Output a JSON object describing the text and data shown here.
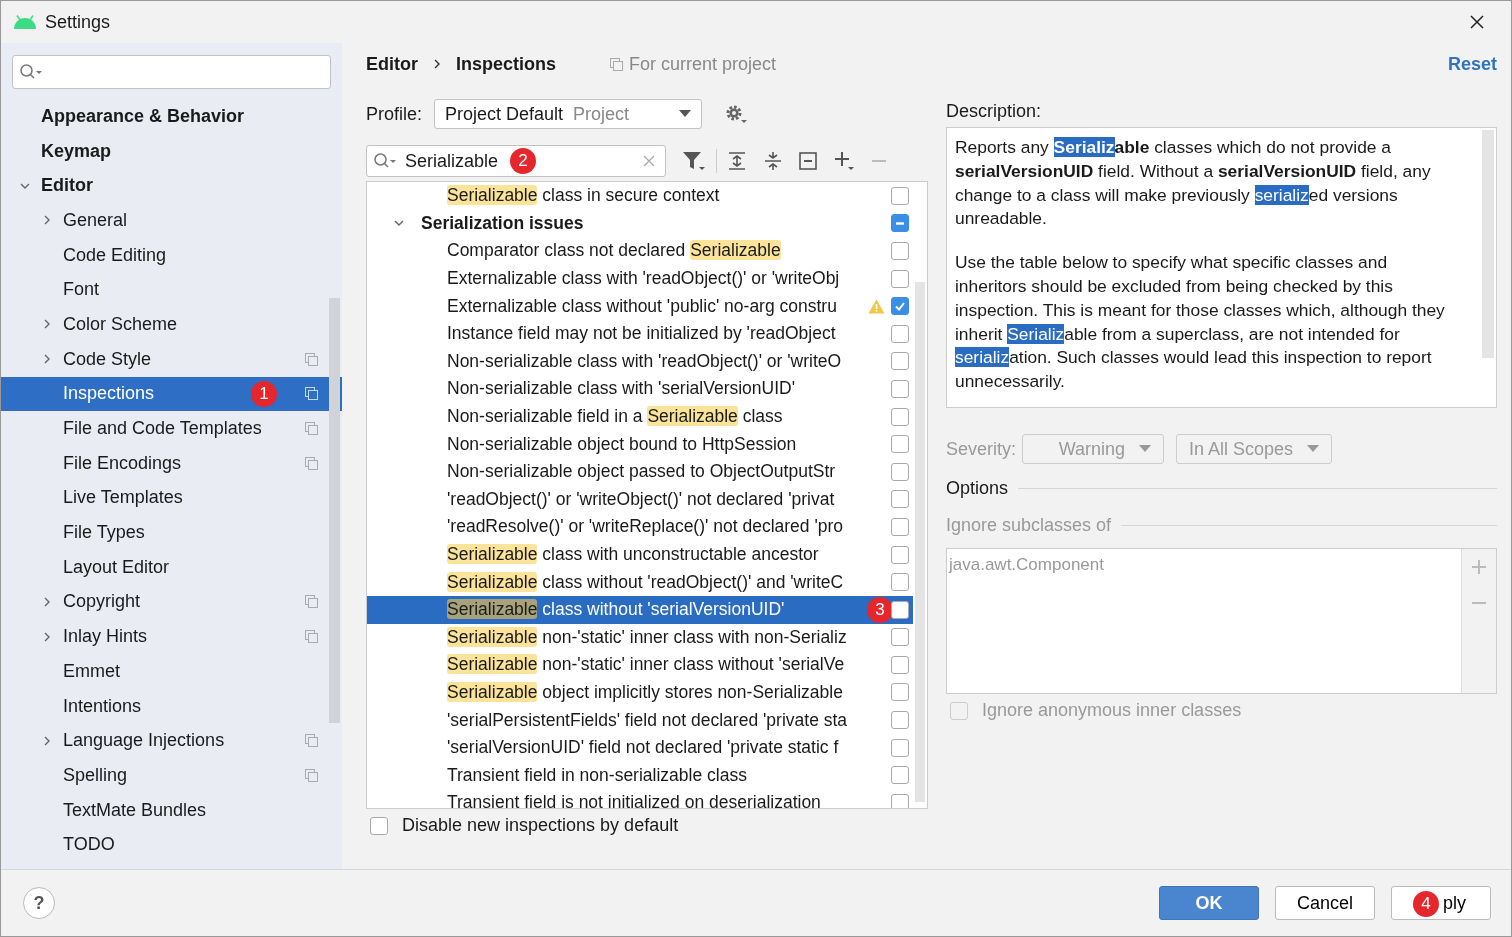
{
  "window": {
    "title": "Settings"
  },
  "sidebar": {
    "items": [
      {
        "label": "Appearance & Behavior",
        "expandable": false,
        "selected": false,
        "project_scope": false
      },
      {
        "label": "Keymap",
        "expandable": false,
        "selected": false,
        "project_scope": false
      },
      {
        "label": "Editor",
        "expandable": true,
        "expanded": true,
        "selected": false,
        "project_scope": false,
        "children": [
          {
            "label": "General",
            "expandable": true,
            "expanded": false,
            "selected": false,
            "project_scope": false
          },
          {
            "label": "Code Editing",
            "expandable": false,
            "selected": false,
            "project_scope": false
          },
          {
            "label": "Font",
            "expandable": false,
            "selected": false,
            "project_scope": false
          },
          {
            "label": "Color Scheme",
            "expandable": true,
            "expanded": false,
            "selected": false,
            "project_scope": false
          },
          {
            "label": "Code Style",
            "expandable": true,
            "expanded": false,
            "selected": false,
            "project_scope": true
          },
          {
            "label": "Inspections",
            "expandable": false,
            "selected": true,
            "project_scope": true,
            "badge": "1"
          },
          {
            "label": "File and Code Templates",
            "expandable": false,
            "selected": false,
            "project_scope": true
          },
          {
            "label": "File Encodings",
            "expandable": false,
            "selected": false,
            "project_scope": true
          },
          {
            "label": "Live Templates",
            "expandable": false,
            "selected": false,
            "project_scope": false
          },
          {
            "label": "File Types",
            "expandable": false,
            "selected": false,
            "project_scope": false
          },
          {
            "label": "Layout Editor",
            "expandable": false,
            "selected": false,
            "project_scope": false
          },
          {
            "label": "Copyright",
            "expandable": true,
            "expanded": false,
            "selected": false,
            "project_scope": true
          },
          {
            "label": "Inlay Hints",
            "expandable": true,
            "expanded": false,
            "selected": false,
            "project_scope": true
          },
          {
            "label": "Emmet",
            "expandable": false,
            "selected": false,
            "project_scope": false
          },
          {
            "label": "Intentions",
            "expandable": false,
            "selected": false,
            "project_scope": false
          },
          {
            "label": "Language Injections",
            "expandable": true,
            "expanded": false,
            "selected": false,
            "project_scope": true
          },
          {
            "label": "Spelling",
            "expandable": false,
            "selected": false,
            "project_scope": true
          },
          {
            "label": "TextMate Bundles",
            "expandable": false,
            "selected": false,
            "project_scope": false
          },
          {
            "label": "TODO",
            "expandable": false,
            "selected": false,
            "project_scope": false
          }
        ]
      }
    ]
  },
  "breadcrumb": [
    "Editor",
    "Inspections"
  ],
  "scope_note": "For current project",
  "reset_link": "Reset",
  "profile": {
    "label": "Profile:",
    "value": "Project Default",
    "qualifier": "Project"
  },
  "filter_search": {
    "value": "Serializable",
    "badge": "2"
  },
  "inspections": [
    {
      "kind": "item",
      "parts": [
        {
          "kind": "match",
          "text": "Serializable"
        },
        {
          "kind": "plain",
          "text": " class in secure context"
        }
      ],
      "checked": false,
      "selected": false,
      "warning": false
    },
    {
      "kind": "group",
      "label": "Serialization issues",
      "expanded": true,
      "checked": false,
      "partial": true,
      "children": [
        {
          "kind": "item",
          "parts": [
            {
              "kind": "plain",
              "text": "Comparator class not declared "
            },
            {
              "kind": "match",
              "text": "Serializable"
            }
          ],
          "checked": false,
          "selected": false,
          "warning": false
        },
        {
          "kind": "item",
          "parts": [
            {
              "kind": "plain",
              "text": "Externalizable class with 'readObject()' or 'writeObj"
            }
          ],
          "checked": false,
          "selected": false,
          "warning": false
        },
        {
          "kind": "item",
          "parts": [
            {
              "kind": "plain",
              "text": "Externalizable class without 'public' no-arg constru"
            }
          ],
          "checked": true,
          "selected": false,
          "warning": true
        },
        {
          "kind": "item",
          "parts": [
            {
              "kind": "plain",
              "text": "Instance field may not be initialized by 'readObject"
            }
          ],
          "checked": false,
          "selected": false,
          "warning": false
        },
        {
          "kind": "item",
          "parts": [
            {
              "kind": "plain",
              "text": "Non-serializable class with 'readObject()' or 'writeO"
            }
          ],
          "checked": false,
          "selected": false,
          "warning": false
        },
        {
          "kind": "item",
          "parts": [
            {
              "kind": "plain",
              "text": "Non-serializable class with 'serialVersionUID'"
            }
          ],
          "checked": false,
          "selected": false,
          "warning": false
        },
        {
          "kind": "item",
          "parts": [
            {
              "kind": "plain",
              "text": "Non-serializable field in a "
            },
            {
              "kind": "match",
              "text": "Serializable"
            },
            {
              "kind": "plain",
              "text": " class"
            }
          ],
          "checked": false,
          "selected": false,
          "warning": false
        },
        {
          "kind": "item",
          "parts": [
            {
              "kind": "plain",
              "text": "Non-serializable object bound to HttpSession"
            }
          ],
          "checked": false,
          "selected": false,
          "warning": false
        },
        {
          "kind": "item",
          "parts": [
            {
              "kind": "plain",
              "text": "Non-serializable object passed to ObjectOutputStr"
            }
          ],
          "checked": false,
          "selected": false,
          "warning": false
        },
        {
          "kind": "item",
          "parts": [
            {
              "kind": "plain",
              "text": "'readObject()' or 'writeObject()' not declared 'privat"
            }
          ],
          "checked": false,
          "selected": false,
          "warning": false
        },
        {
          "kind": "item",
          "parts": [
            {
              "kind": "plain",
              "text": "'readResolve()' or 'writeReplace()' not declared 'pro"
            }
          ],
          "checked": false,
          "selected": false,
          "warning": false
        },
        {
          "kind": "item",
          "parts": [
            {
              "kind": "match",
              "text": "Serializable"
            },
            {
              "kind": "plain",
              "text": " class with unconstructable ancestor"
            }
          ],
          "checked": false,
          "selected": false,
          "warning": false
        },
        {
          "kind": "item",
          "parts": [
            {
              "kind": "match",
              "text": "Serializable"
            },
            {
              "kind": "plain",
              "text": " class without 'readObject()' and 'writeC"
            }
          ],
          "checked": false,
          "selected": false,
          "warning": false
        },
        {
          "kind": "item",
          "parts": [
            {
              "kind": "match",
              "text": "Serializable"
            },
            {
              "kind": "plain",
              "text": " class without 'serialVersionUID'"
            }
          ],
          "checked": false,
          "selected": true,
          "warning": false,
          "badge": "3"
        },
        {
          "kind": "item",
          "parts": [
            {
              "kind": "match",
              "text": "Serializable"
            },
            {
              "kind": "plain",
              "text": " non-'static' inner class with non-Serializ"
            }
          ],
          "checked": false,
          "selected": false,
          "warning": false
        },
        {
          "kind": "item",
          "parts": [
            {
              "kind": "match",
              "text": "Serializable"
            },
            {
              "kind": "plain",
              "text": " non-'static' inner class without 'serialVe"
            }
          ],
          "checked": false,
          "selected": false,
          "warning": false
        },
        {
          "kind": "item",
          "parts": [
            {
              "kind": "match",
              "text": "Serializable"
            },
            {
              "kind": "plain",
              "text": " object implicitly stores non-Serializable"
            }
          ],
          "checked": false,
          "selected": false,
          "warning": false
        },
        {
          "kind": "item",
          "parts": [
            {
              "kind": "plain",
              "text": "'serialPersistentFields' field not declared 'private sta"
            }
          ],
          "checked": false,
          "selected": false,
          "warning": false
        },
        {
          "kind": "item",
          "parts": [
            {
              "kind": "plain",
              "text": "'serialVersionUID' field not declared 'private static f"
            }
          ],
          "checked": false,
          "selected": false,
          "warning": false
        },
        {
          "kind": "item",
          "parts": [
            {
              "kind": "plain",
              "text": "Transient field in non-serializable class"
            }
          ],
          "checked": false,
          "selected": false,
          "warning": false
        },
        {
          "kind": "item",
          "parts": [
            {
              "kind": "plain",
              "text": "Transient field is not initialized on deserialization"
            }
          ],
          "checked": false,
          "selected": false,
          "warning": false
        }
      ]
    }
  ],
  "disable_new": {
    "label": "Disable new inspections by default",
    "checked": false
  },
  "description": {
    "label": "Description:",
    "paragraphs": [
      [
        {
          "kind": "plain",
          "text": "Reports any "
        },
        {
          "kind": "bold_selected",
          "text": "Serializ"
        },
        {
          "kind": "bold",
          "text": "able"
        },
        {
          "kind": "plain",
          "text": " classes which do not provide a "
        },
        {
          "kind": "bold",
          "text": "serialVersionUID"
        },
        {
          "kind": "plain",
          "text": " field. Without a "
        },
        {
          "kind": "bold",
          "text": "serialVersionUID"
        },
        {
          "kind": "plain",
          "text": " field, any change to a class will make previously "
        },
        {
          "kind": "selected",
          "text": "serializ"
        },
        {
          "kind": "plain",
          "text": "ed versions unreadable."
        }
      ],
      [
        {
          "kind": "plain",
          "text": "Use the table below to specify what specific classes and inheritors should be excluded from being checked by this inspection. This is meant for those classes which, although they inherit "
        },
        {
          "kind": "selected",
          "text": "Serializ"
        },
        {
          "kind": "plain",
          "text": "able from a superclass, are not intended for "
        },
        {
          "kind": "selected",
          "text": "serializ"
        },
        {
          "kind": "plain",
          "text": "ation. Such classes would lead this inspection to report unnecessarily."
        }
      ]
    ]
  },
  "severity": {
    "label": "Severity:",
    "value": "Warning",
    "scope": "In All Scopes",
    "disabled": true
  },
  "options": {
    "title": "Options",
    "ignore_title": "Ignore subclasses of",
    "classes": [
      "java.awt.Component"
    ],
    "disabled": true,
    "anonymous": {
      "label": "Ignore anonymous inner classes",
      "checked": false
    }
  },
  "footer": {
    "help": "?",
    "ok": "OK",
    "cancel": "Cancel",
    "apply": "ply",
    "apply_badge": "4"
  }
}
